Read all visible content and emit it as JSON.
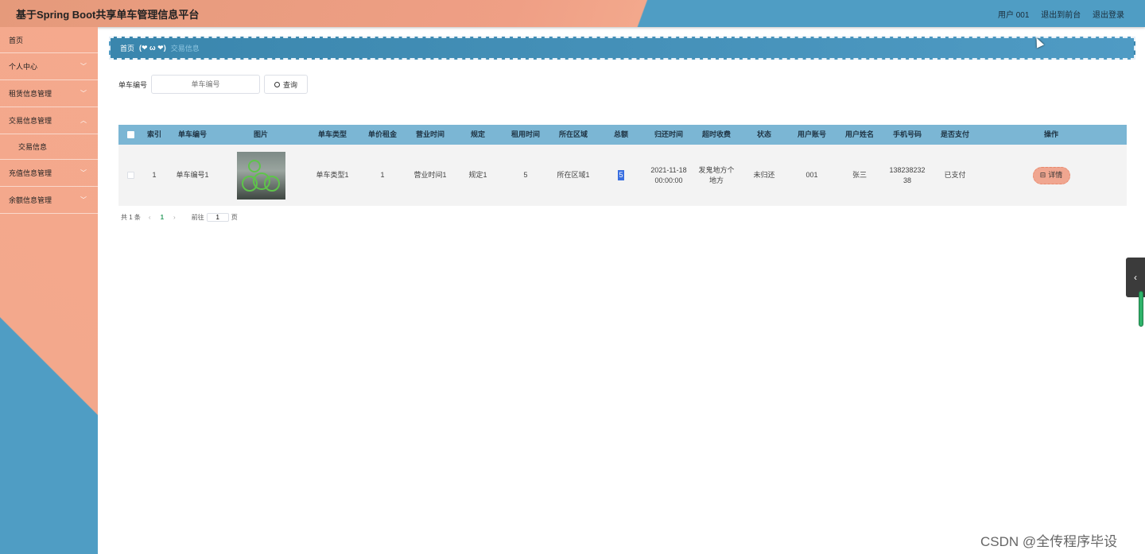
{
  "header": {
    "title": "基于Spring Boot共享单车管理信息平台",
    "user": "用户 001",
    "back_frontend": "退出到前台",
    "logout": "退出登录"
  },
  "sidebar": {
    "items": [
      {
        "label": "首页"
      },
      {
        "label": "个人中心"
      },
      {
        "label": "租赁信息管理"
      },
      {
        "label": "交易信息管理"
      },
      {
        "label": "交易信息"
      },
      {
        "label": "充值信息管理"
      },
      {
        "label": "余额信息管理"
      }
    ]
  },
  "breadcrumb": {
    "home": "首页",
    "separator": "(❤ ω ❤)",
    "current": "交易信息"
  },
  "search": {
    "label": "单车编号",
    "placeholder": "单车编号",
    "button": "查询"
  },
  "table": {
    "headers": [
      "",
      "索引",
      "单车编号",
      "图片",
      "单车类型",
      "单价租金",
      "营业时间",
      "规定",
      "租用时间",
      "所在区域",
      "总额",
      "归还时间",
      "超时收费",
      "状态",
      "用户账号",
      "用户姓名",
      "手机号码",
      "是否支付",
      "操作"
    ],
    "rows": [
      {
        "index": "1",
        "bike_no": "单车编号1",
        "bike_type": "单车类型1",
        "price": "1",
        "hours": "营业时间1",
        "rule": "规定1",
        "rent_time": "5",
        "area": "所在区域1",
        "total": "5",
        "return_time": "2021-11-18 00:00:00",
        "overtime_fee": "发鬼地方个地方",
        "status": "未归还",
        "account": "001",
        "name": "张三",
        "phone": "13823823238",
        "paid": "已支付",
        "action": "详情"
      }
    ]
  },
  "pager": {
    "total": "共 1 条",
    "prev": "‹",
    "page": "1",
    "next": "›",
    "goto": "前往",
    "goto_value": "1",
    "unit": "页"
  },
  "watermark": "CSDN @全传程序毕设",
  "colors": {
    "header_left": "#e59a7b",
    "header_right": "#4f9dc4",
    "sidebar": "#f3a88c",
    "table_head": "#7bb6d4",
    "detail_button": "#f0a690"
  }
}
